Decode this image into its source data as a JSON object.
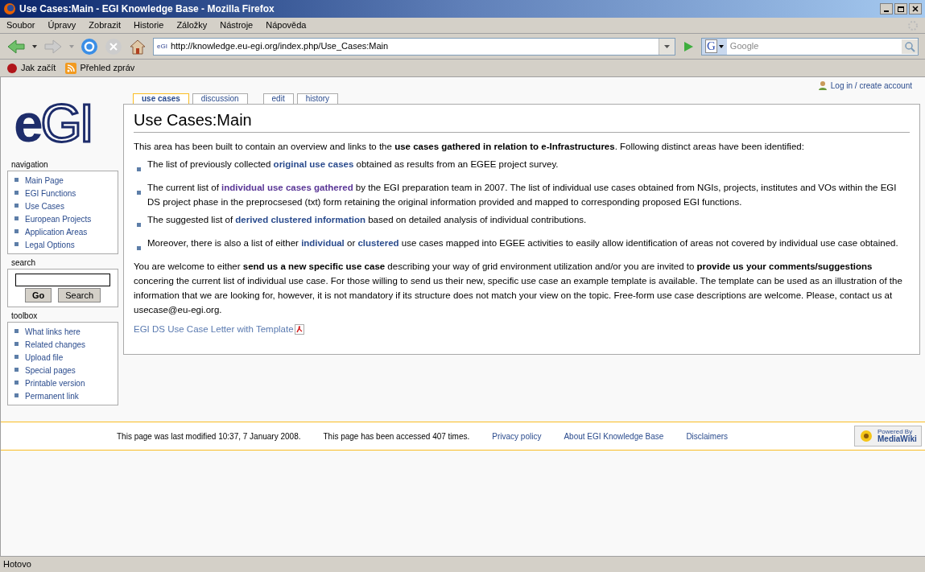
{
  "window": {
    "title": "Use Cases:Main - EGI Knowledge Base - Mozilla Firefox"
  },
  "menu": [
    "Soubor",
    "Úpravy",
    "Zobrazit",
    "Historie",
    "Záložky",
    "Nástroje",
    "Nápověda"
  ],
  "toolbar": {
    "site_icon_text": "eGI",
    "url": "http://knowledge.eu-egi.org/index.php/Use_Cases:Main",
    "search_engine": "G",
    "search_placeholder": "Google"
  },
  "bookmarks": [
    "Jak začít",
    "Přehled zpráv"
  ],
  "logo": {
    "part_1": "e",
    "part_2": "GI"
  },
  "user_link": "Log in / create account",
  "tabs": [
    {
      "label": "use cases",
      "selected": true
    },
    {
      "label": "discussion",
      "selected": false
    },
    {
      "label": "edit",
      "selected": false
    },
    {
      "label": "history",
      "selected": false
    }
  ],
  "sidebar": [
    {
      "title": "navigation",
      "kind": "links",
      "items": [
        "Main Page",
        "EGI Functions",
        "Use Cases",
        "European Projects",
        "Application Areas",
        "Legal Options"
      ]
    },
    {
      "title": "search",
      "kind": "search",
      "buttons": [
        "Go",
        "Search"
      ]
    },
    {
      "title": "toolbox",
      "kind": "links",
      "items": [
        "What links here",
        "Related changes",
        "Upload file",
        "Special pages",
        "Printable version",
        "Permanent link"
      ]
    }
  ],
  "page_title": "Use Cases:Main",
  "intro": [
    {
      "kind": "text",
      "text": "This area has been built to contain an overview and links to the "
    },
    {
      "kind": "bold",
      "text": "use cases gathered in relation to e-Infrastructures"
    },
    {
      "kind": "text",
      "text": ". Following distinct areas have been identified:"
    }
  ],
  "bullets": [
    [
      {
        "kind": "text",
        "text": "The list of previously collected "
      },
      {
        "kind": "link",
        "text": "original use cases"
      },
      {
        "kind": "text",
        "text": " obtained as results from an EGEE project survey."
      }
    ],
    [
      {
        "kind": "text",
        "text": "The current list of "
      },
      {
        "kind": "visited",
        "text": "individual use cases gathered"
      },
      {
        "kind": "text",
        "text": " by the EGI preparation team in 2007. The list of individual use cases obtained from NGIs, projects, institutes and VOs within the EGI DS project phase in the preprocsesed (txt) form retaining the original information provided and mapped to corresponding proposed EGI functions."
      }
    ],
    [
      {
        "kind": "text",
        "text": "The suggested list of "
      },
      {
        "kind": "link",
        "text": "derived clustered information"
      },
      {
        "kind": "text",
        "text": " based on detailed analysis of individual contributions."
      }
    ],
    [
      {
        "kind": "text",
        "text": "Moreover, there is also a list of either "
      },
      {
        "kind": "link",
        "text": "individual"
      },
      {
        "kind": "text",
        "text": " or "
      },
      {
        "kind": "link",
        "text": "clustered"
      },
      {
        "kind": "text",
        "text": " use cases mapped into EGEE activities to easily allow identification of areas not covered by individual use case obtained."
      }
    ]
  ],
  "closing": [
    {
      "kind": "text",
      "text": "You are welcome to either "
    },
    {
      "kind": "bold",
      "text": "send us a new specific use case"
    },
    {
      "kind": "text",
      "text": " describing your way of grid environment utilization and/or you are invited to "
    },
    {
      "kind": "bold",
      "text": "provide us your comments/suggestions"
    },
    {
      "kind": "text",
      "text": " concering the current list of individual use case. For those willing to send us their new, specific use case an example template is available. The template can be used as an illustration of the information that we are looking for, however, it is not mandatory if its structure does not match your view on the topic. Free-form use case descriptions are welcome. Please, contact us at usecase@eu-egi.org."
    }
  ],
  "file_link": "EGI DS Use Case Letter with Template",
  "footer": [
    {
      "kind": "text",
      "text": "This page was last modified 10:37, 7 January 2008."
    },
    {
      "kind": "text",
      "text": "This page has been accessed 407 times."
    },
    {
      "kind": "link",
      "text": "Privacy policy"
    },
    {
      "kind": "link",
      "text": "About EGI Knowledge Base"
    },
    {
      "kind": "link",
      "text": "Disclaimers"
    }
  ],
  "badge": {
    "line_1": "Powered By",
    "line_2": "MediaWiki"
  },
  "status_bar": "Hotovo"
}
